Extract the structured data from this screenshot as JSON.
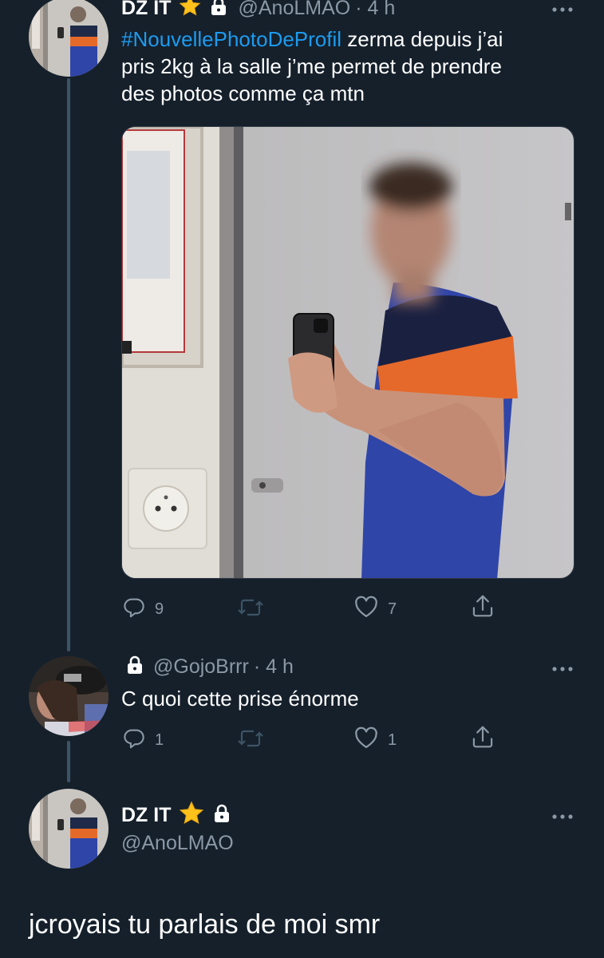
{
  "tweet1": {
    "name": "DZ IT",
    "handle": "@AnoLMAO",
    "time": "· 4 h",
    "hashtag": "#NouvellePhotoDeProfil",
    "text_line1_rest": " zerma depuis j’ai",
    "text_line2": "pris 2kg à la salle j’me permet de prendre",
    "text_line3": "des photos comme ça mtn",
    "replies": "9",
    "likes": "7"
  },
  "tweet2": {
    "handle": "@GojoBrrr",
    "time": "· 4 h",
    "text": "C quoi cette prise énorme",
    "replies": "1",
    "likes": "1"
  },
  "tweet3": {
    "name": "DZ IT",
    "handle": "@AnoLMAO",
    "text": "jcroyais tu parlais de moi smr"
  },
  "icons": {
    "verified_like_badge": "star-emoji-icon",
    "protected": "lock-icon",
    "reply": "reply-icon",
    "retweet": "retweet-icon",
    "like": "heart-icon",
    "share": "share-icon",
    "more": "more-icon"
  },
  "colors": {
    "background": "#15202b",
    "hashtag": "#1d9bf0",
    "secondary_text": "#8b98a5",
    "thread_line": "#3d5466"
  }
}
